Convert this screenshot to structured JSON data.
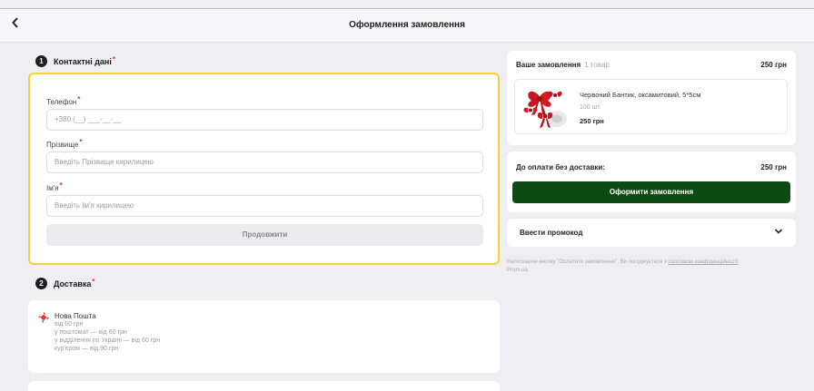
{
  "header": {
    "back_icon": "chevron-left-icon",
    "title": "Оформлення замовлення"
  },
  "contacts": {
    "step_number": "1",
    "title": "Контактні дані",
    "required_mark": "*",
    "phone": {
      "label": "Телефон",
      "placeholder": "+380 (__) ___-__-__"
    },
    "surname": {
      "label": "Прізвище",
      "placeholder": "Введіть Прізвище кирилицею"
    },
    "name": {
      "label": "Ім'я",
      "placeholder": "Введіть Ім'я кирилицею"
    },
    "continue_label": "Продовжити"
  },
  "delivery": {
    "step_number": "2",
    "title": "Доставка",
    "required_mark": "*",
    "option": {
      "icon": "nova-poshta-icon",
      "name": "Нова Пошта",
      "lines": [
        "від 60 грн",
        "у поштомат — від 60 грн",
        "у відділення по Україні — від 60 грн",
        "кур'єром — від 90 грн"
      ]
    }
  },
  "order": {
    "title": "Ваше замовлення",
    "count": "1 товар",
    "total": "250 грн",
    "product": {
      "name": "Червоний Бантик, оксамитовий, 5*5см",
      "qty": "100 шт.",
      "price": "250 грн"
    }
  },
  "payment": {
    "label": "До оплати без доставки:",
    "total": "250 грн",
    "submit_label": "Оформити замовлення"
  },
  "promo": {
    "label": "Ввести промокод",
    "icon": "chevron-down-icon"
  },
  "legal": {
    "text": "Натискаючи кнопку \"Оплатити замовлення\", Ви погоджуєтеся з ",
    "link": "політикою конфіденційності",
    "suffix": "Prom.ua."
  },
  "colors": {
    "accent_green": "#0d4a14",
    "highlight_yellow": "#f4d23c",
    "required_red": "#e03030"
  }
}
